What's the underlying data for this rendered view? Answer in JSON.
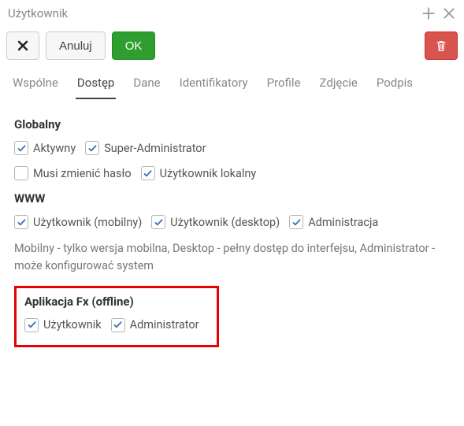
{
  "titlebar": {
    "title": "Użytkownik"
  },
  "toolbar": {
    "cancel_label": "Anuluj",
    "ok_label": "OK"
  },
  "tabs": {
    "items": [
      {
        "label": "Wspólne"
      },
      {
        "label": "Dostęp"
      },
      {
        "label": "Dane"
      },
      {
        "label": "Identifikatory"
      },
      {
        "label": "Profile"
      },
      {
        "label": "Zdjęcie"
      },
      {
        "label": "Podpis"
      }
    ],
    "active_index": 1
  },
  "sections": {
    "global": {
      "title": "Globalny",
      "checks": {
        "active": {
          "label": "Aktywny",
          "checked": true
        },
        "super_admin": {
          "label": "Super-Administrator",
          "checked": true
        },
        "must_change_pw": {
          "label": "Musi zmienić hasło",
          "checked": false
        },
        "local_user": {
          "label": "Użytkownik lokalny",
          "checked": true
        }
      }
    },
    "www": {
      "title": "WWW",
      "checks": {
        "user_mobile": {
          "label": "Użytkownik (mobilny)",
          "checked": true
        },
        "user_desktop": {
          "label": "Użytkownik (desktop)",
          "checked": true
        },
        "administration": {
          "label": "Administracja",
          "checked": true
        }
      },
      "help": "Mobilny - tylko wersja mobilna, Desktop - pełny dostęp do interfejsu, Administrator - może konfigurować system"
    },
    "fx": {
      "title": "Aplikacja Fx (offline)",
      "checks": {
        "user": {
          "label": "Użytkownik",
          "checked": true
        },
        "admin": {
          "label": "Administrator",
          "checked": true
        }
      }
    }
  },
  "colors": {
    "ok_bg": "#2e9e2e",
    "delete_bg": "#d9534f",
    "highlight_border": "#e60000",
    "check_mark": "#3b6fb6"
  }
}
